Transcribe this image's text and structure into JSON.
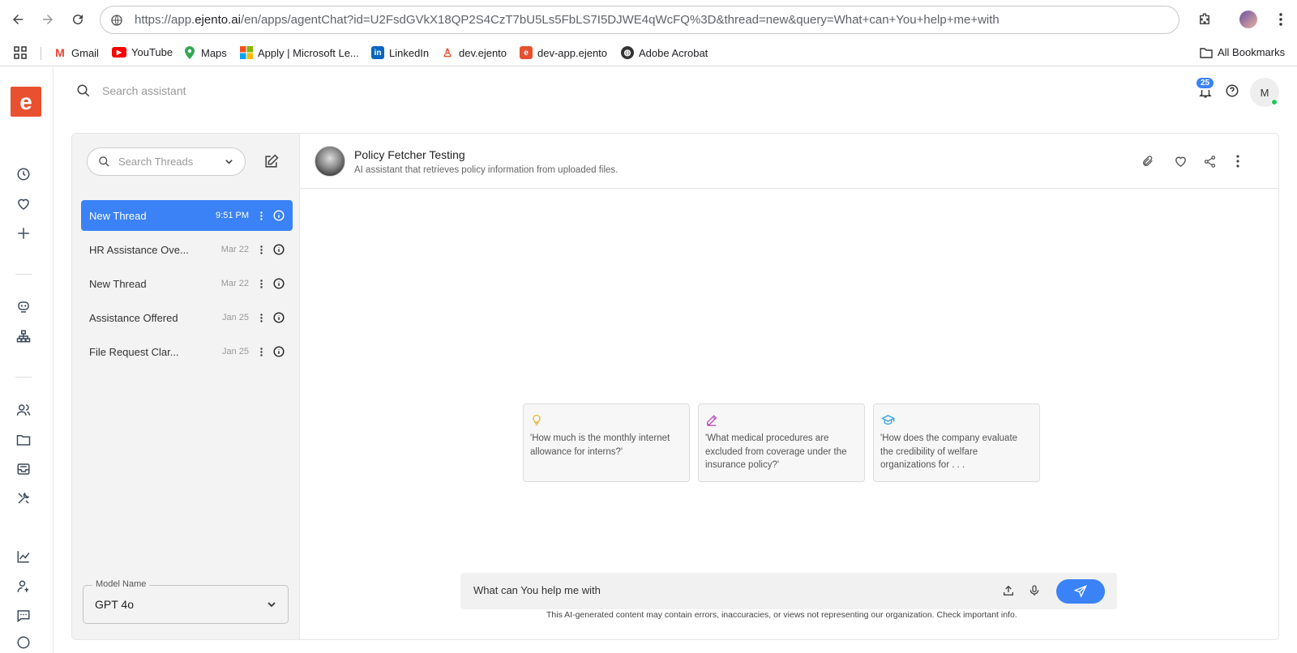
{
  "browser": {
    "url_prefix": "https://app.",
    "url_host": "ejento.ai",
    "url_path": "/en/apps/agentChat?id=U2FsdGVkX18QP2S4CzT7bU5Ls5FbLS7I5DJWE4qWcFQ%3D&thread=new&query=What+can+You+help+me+with",
    "bookmarks": [
      {
        "label": "Gmail"
      },
      {
        "label": "YouTube"
      },
      {
        "label": "Maps"
      },
      {
        "label": "Apply | Microsoft Le..."
      },
      {
        "label": "LinkedIn"
      },
      {
        "label": "dev.ejento"
      },
      {
        "label": "dev-app.ejento"
      },
      {
        "label": "Adobe Acrobat"
      }
    ],
    "all_bookmarks": "All Bookmarks"
  },
  "app": {
    "logo_letter": "e",
    "search_placeholder": "Search assistant",
    "notification_count": "25",
    "user_initial": "M"
  },
  "threads": {
    "search_placeholder": "Search Threads",
    "items": [
      {
        "title": "New Thread",
        "date": "9:51 PM",
        "active": true
      },
      {
        "title": "HR Assistance Ove...",
        "date": "Mar 22",
        "active": false
      },
      {
        "title": "New Thread",
        "date": "Mar 22",
        "active": false
      },
      {
        "title": "Assistance Offered",
        "date": "Jan 25",
        "active": false
      },
      {
        "title": "File Request Clar...",
        "date": "Jan 25",
        "active": false
      }
    ],
    "model_label": "Model Name",
    "model_value": "GPT 4o"
  },
  "chat": {
    "agent_name": "Policy Fetcher Testing",
    "agent_description": "AI assistant that retrieves policy information from uploaded files.",
    "prompts": [
      {
        "icon": "lightbulb-icon",
        "color": "#e5b83a",
        "text": "'How much is the monthly internet allowance for interns?'"
      },
      {
        "icon": "pencil-icon",
        "color": "#c04fbf",
        "text": "'What medical procedures are excluded from coverage under the insurance policy?'"
      },
      {
        "icon": "graduation-cap-icon",
        "color": "#3fa7e0",
        "text": "'How does the company evaluate the credibility of welfare organizations for . . ."
      }
    ],
    "input_value": "What can You help me with",
    "disclaimer": "This AI-generated content may contain errors, inaccuracies, or views not representing our organization. Check important info."
  },
  "colors": {
    "accent": "#3b82f6",
    "brand": "#e8502f"
  }
}
